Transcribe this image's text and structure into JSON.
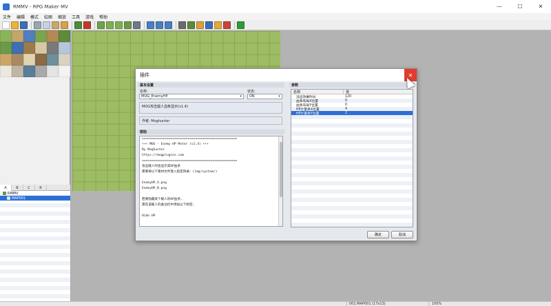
{
  "window": {
    "title": "RMMV - RPG Maker MV",
    "controls": {
      "minimize": "—",
      "maximize": "☐",
      "close": "✕"
    }
  },
  "menubar": [
    "文件",
    "编辑",
    "模式",
    "绘图",
    "缩放",
    "工具",
    "游戏",
    "帮助"
  ],
  "toolbar": {
    "buttons": [
      {
        "icon": "new-project-icon",
        "color": "#ffffff"
      },
      {
        "icon": "open-project-icon",
        "color": "#e9b43a"
      },
      {
        "icon": "save-project-icon",
        "color": "#3d6fb8"
      },
      {
        "icon": "cut-icon",
        "color": "#9aa7b5"
      },
      {
        "icon": "copy-icon",
        "color": "#c8d2dd"
      },
      {
        "icon": "paste-icon",
        "color": "#c9a86b"
      },
      {
        "icon": "undo-icon",
        "color": "#d2a34a"
      },
      {
        "icon": "map-mode-icon",
        "color": "#4d8a3b"
      },
      {
        "icon": "event-mode-icon",
        "color": "#c0392b"
      },
      {
        "icon": "pencil-icon",
        "color": "#6da34a"
      },
      {
        "icon": "rectangle-icon",
        "color": "#7fb050"
      },
      {
        "icon": "ellipse-icon",
        "color": "#7fb050"
      },
      {
        "icon": "fill-icon",
        "color": "#6c9a44"
      },
      {
        "icon": "shadow-pen-icon",
        "color": "#6c7a8a"
      },
      {
        "icon": "zoom-in-icon",
        "color": "#4a7fc0"
      },
      {
        "icon": "zoom-out-icon",
        "color": "#4a7fc0"
      },
      {
        "icon": "actual-size-icon",
        "color": "#4a7fc0"
      },
      {
        "icon": "database-icon",
        "color": "#6c6c6c"
      },
      {
        "icon": "plugin-manager-icon",
        "color": "#5a8a3c"
      },
      {
        "icon": "sound-test-icon",
        "color": "#d6a23a"
      },
      {
        "icon": "event-searcher-icon",
        "color": "#3b6fb5"
      },
      {
        "icon": "resource-manager-icon",
        "color": "#e0a93c"
      },
      {
        "icon": "character-generator-icon",
        "color": "#c8453a"
      },
      {
        "icon": "playtest-icon",
        "color": "#2f9a3a"
      }
    ],
    "separators_after": [
      2,
      6,
      8,
      13,
      16,
      22
    ]
  },
  "tileset": {
    "tiles": [
      "#8bb35a",
      "#c4a66a",
      "#4f7fbf",
      "#7aa54d",
      "#b38a55",
      "#5e8a3b",
      "#6b9b4a",
      "#3f6fb0",
      "#9c7b4b",
      "#d6c9a3",
      "#7a7a7a",
      "#b5c7d8",
      "#caa56a",
      "#a88b62",
      "#e2d3b1",
      "#8a6b45",
      "#6e8f9c",
      "#d9d2c3",
      "#ece8df",
      "#bfb6a4",
      "#5a7d9a",
      "#a9a9a9",
      "#e4e4e4",
      "#f3f3f3"
    ]
  },
  "map_tabs": [
    "A",
    "B",
    "C",
    "R"
  ],
  "map_tree": {
    "project": "RMMV",
    "map": "MAP001"
  },
  "dialog": {
    "title": "插件",
    "basic_group": "基本设置",
    "name_label": "名称:",
    "name_value": "MOG_EnemyHP",
    "status_label": "状态:",
    "status_value": "ON",
    "description": "MOG攻击敌人血条显示(v1.4)",
    "author": "作者: Moghunter",
    "help_group": "帮助",
    "help_lines": [
      "==================================================",
      "+++ MOG - Enemy HP Meter (v1.4) +++",
      "By Moghunter",
      "https://mogplugins.com",
      "==================================================",
      "攻击敌人时会显示其HP血条",
      "需要将以下素材文件放入指定目录：(img/system/)",
      "",
      "EnemyHP_A.png",
      "EnemyHP_B.png",
      "",
      "若要隐藏某个敌人的HP血条，",
      "需在该敌人的备注栏中添加以下标签：",
      "",
      "Hide HP",
      "",
      "=================================================="
    ],
    "params_group": "参数",
    "params_columns": [
      "名称",
      "值"
    ],
    "params": [
      {
        "name": "淡出效果时长",
        "value": "120"
      },
      {
        "name": "血条布局X位置",
        "value": "0"
      },
      {
        "name": "血条布局Y位置",
        "value": "0"
      },
      {
        "name": "HP计量条X位置",
        "value": "4"
      },
      {
        "name": "HP计量条Y位置",
        "value": "2"
      }
    ],
    "selected_param": 4,
    "ok_label": "确定",
    "cancel_label": "取消"
  },
  "statusbar": {
    "map_info": "001:MAP001 (17x13)",
    "zoom": "100%"
  }
}
